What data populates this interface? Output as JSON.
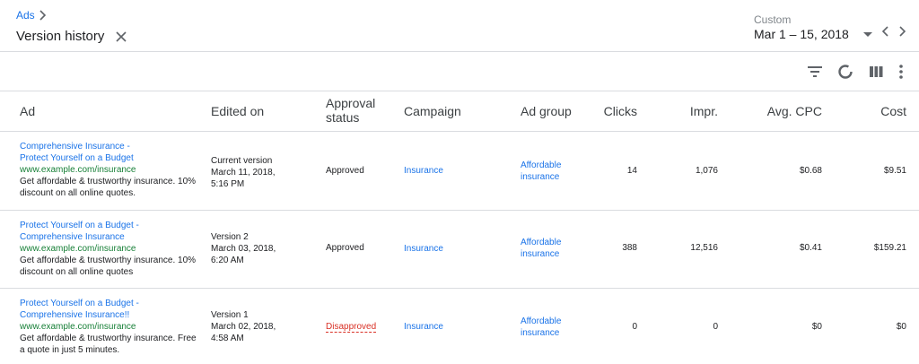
{
  "header": {
    "breadcrumb": "Ads",
    "title": "Version history"
  },
  "date_range": {
    "label": "Custom",
    "value": "Mar 1 – 15, 2018"
  },
  "toolbar": {
    "icons": [
      "filter-icon",
      "segment-icon",
      "columns-icon",
      "more-vert-icon"
    ]
  },
  "table": {
    "headers": {
      "ad": "Ad",
      "edited_on": "Edited on",
      "approval_status": "Approval status",
      "campaign": "Campaign",
      "ad_group": "Ad group",
      "clicks": "Clicks",
      "impr": "Impr.",
      "avg_cpc": "Avg. CPC",
      "cost": "Cost"
    },
    "rows": [
      {
        "headline1": "Comprehensive Insurance -",
        "headline2": "Protect Yourself on a Budget",
        "url": "www.example.com/insurance",
        "desc1": "Get affordable & trustworthy insurance. 10%",
        "desc2": "discount on all online quotes.",
        "version": "Current version",
        "date": "March 11, 2018,",
        "time": "5:16 PM",
        "status": "Approved",
        "campaign": "Insurance",
        "ad_group1": "Affordable",
        "ad_group2": "insurance",
        "clicks": "14",
        "impr": "1,076",
        "avg_cpc": "$0.68",
        "cost": "$9.51"
      },
      {
        "headline1": "Protect Yourself on a Budget -",
        "headline2": "Comprehensive Insurance",
        "url": "www.example.com/insurance",
        "desc1": "Get affordable & trustworthy insurance. 10%",
        "desc2": "discount on all online quotes",
        "version": "Version 2",
        "date": "March 03, 2018,",
        "time": "6:20 AM",
        "status": "Approved",
        "campaign": "Insurance",
        "ad_group1": "Affordable",
        "ad_group2": "insurance",
        "clicks": "388",
        "impr": "12,516",
        "avg_cpc": "$0.41",
        "cost": "$159.21"
      },
      {
        "headline1": "Protect Yourself on a Budget -",
        "headline2": "Comprehensive Insurance!!",
        "url": "www.example.com/insurance",
        "desc1": "Get affordable & trustworthy insurance. Free",
        "desc2": "a quote in just 5 minutes.",
        "version": "Version 1",
        "date": "March 02, 2018,",
        "time": "4:58 AM",
        "status": "Disapproved",
        "campaign": "Insurance",
        "ad_group1": "Affordable",
        "ad_group2": "insurance",
        "clicks": "0",
        "impr": "0",
        "avg_cpc": "$0",
        "cost": "$0"
      }
    ]
  }
}
